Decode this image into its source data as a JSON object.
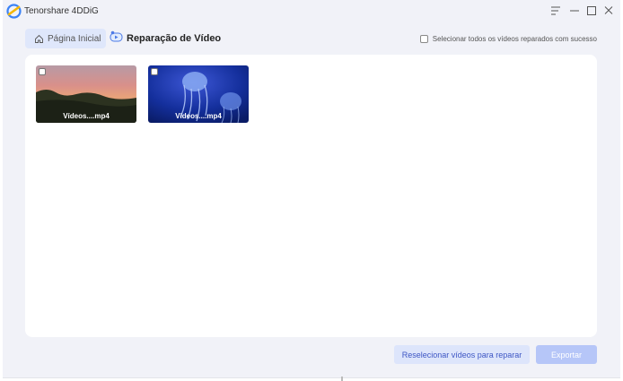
{
  "app": {
    "title": "Tenorshare 4DDiG"
  },
  "nav": {
    "home_label": "Página Inicial",
    "page_title": "Reparação de Vídeo"
  },
  "select_all": {
    "label": "Selecionar todos os vídeos reparados com sucesso",
    "checked": false
  },
  "videos": [
    {
      "name": "Vídeos....mp4",
      "thumbnail": "sunset-landscape",
      "checked": false
    },
    {
      "name": "Vídeos....mp4",
      "thumbnail": "jellyfish-underwater",
      "checked": false
    }
  ],
  "actions": {
    "reselect_label": "Reselecionar vídeos para reparar",
    "export_label": "Exportar"
  },
  "colors": {
    "accent": "#3d56c4",
    "window_bg": "#f1f2f8",
    "home_tab_bg": "#dfe7fb",
    "export_disabled": "#b6c6f8"
  }
}
